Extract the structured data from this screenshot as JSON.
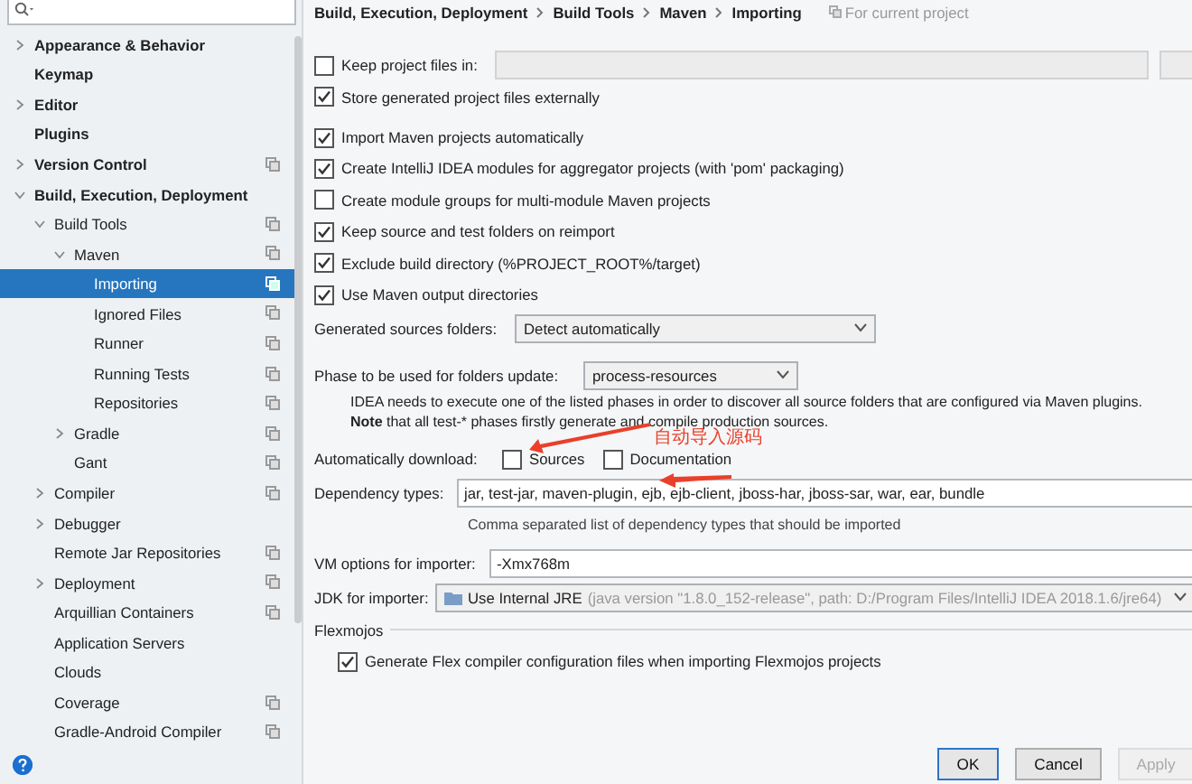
{
  "sidebar": {
    "tree": [
      {
        "label": "Appearance & Behavior",
        "expanded": false,
        "project_level": false,
        "selected": false
      },
      {
        "label": "Keymap",
        "project_level": false,
        "selected": false
      },
      {
        "label": "Editor",
        "expanded": false,
        "project_level": false,
        "selected": false
      },
      {
        "label": "Plugins",
        "project_level": false,
        "selected": false
      },
      {
        "label": "Version Control",
        "expanded": false,
        "project_level": true,
        "selected": false
      },
      {
        "label": "Build, Execution, Deployment",
        "expanded": true,
        "project_level": false,
        "selected": false,
        "children": [
          {
            "label": "Build Tools",
            "expanded": true,
            "project_level": true,
            "selected": false,
            "children": [
              {
                "label": "Maven",
                "expanded": true,
                "project_level": true,
                "selected": false,
                "children": [
                  {
                    "label": "Importing",
                    "project_level": true,
                    "selected": true
                  },
                  {
                    "label": "Ignored Files",
                    "project_level": true,
                    "selected": false
                  },
                  {
                    "label": "Runner",
                    "project_level": true,
                    "selected": false
                  },
                  {
                    "label": "Running Tests",
                    "project_level": true,
                    "selected": false
                  },
                  {
                    "label": "Repositories",
                    "project_level": true,
                    "selected": false
                  }
                ]
              },
              {
                "label": "Gradle",
                "expanded": false,
                "project_level": true,
                "selected": false
              },
              {
                "label": "Gant",
                "project_level": true,
                "selected": false
              }
            ]
          },
          {
            "label": "Compiler",
            "expanded": false,
            "project_level": true,
            "selected": false
          },
          {
            "label": "Debugger",
            "expanded": false,
            "project_level": false,
            "selected": false
          },
          {
            "label": "Remote Jar Repositories",
            "project_level": true,
            "selected": false
          },
          {
            "label": "Deployment",
            "expanded": false,
            "project_level": true,
            "selected": false
          },
          {
            "label": "Arquillian Containers",
            "project_level": true,
            "selected": false
          },
          {
            "label": "Application Servers",
            "project_level": false,
            "selected": false
          },
          {
            "label": "Clouds",
            "project_level": false,
            "selected": false
          },
          {
            "label": "Coverage",
            "project_level": true,
            "selected": false
          },
          {
            "label": "Gradle-Android Compiler",
            "project_level": true,
            "selected": false
          }
        ]
      }
    ]
  },
  "breadcrumb": [
    "Build, Execution, Deployment",
    "Build Tools",
    "Maven",
    "Importing"
  ],
  "scope_note": "For current project",
  "keep_project_files": {
    "label": "Keep project files in:",
    "checked": false
  },
  "store_externally": {
    "label": "Store generated project files externally",
    "checked": true
  },
  "import_options": [
    {
      "label": "Import Maven projects automatically",
      "checked": true
    },
    {
      "label": "Create IntelliJ IDEA modules for aggregator projects (with 'pom' packaging)",
      "checked": true
    },
    {
      "label": "Create module groups for multi-module Maven projects",
      "checked": false
    },
    {
      "label": "Keep source and test folders on reimport",
      "checked": true
    },
    {
      "label": "Exclude build directory (%PROJECT_ROOT%/target)",
      "checked": true
    },
    {
      "label": "Use Maven output directories",
      "checked": true
    }
  ],
  "generated_sources": {
    "label": "Generated sources folders:",
    "value": "Detect automatically"
  },
  "phase": {
    "label": "Phase to be used for folders update:",
    "value": "process-resources",
    "note": "IDEA needs to execute one of the listed phases in order to discover all source folders that are configured via Maven plugins.",
    "note2": "**Note** that all test-* phases firstly generate and compile production sources."
  },
  "auto_download": {
    "label": "Automatically download:",
    "options": [
      {
        "label": "Sources",
        "checked": false
      },
      {
        "label": "Documentation",
        "checked": false
      }
    ]
  },
  "dependency_types": {
    "label": "Dependency types:",
    "value": "jar, test-jar, maven-plugin, ejb, ejb-client, jboss-har, jboss-sar, war, ear, bundle",
    "hint": "Comma separated list of dependency types that should be imported"
  },
  "vm_options": {
    "label": "VM options for importer:",
    "value": "-Xmx768m"
  },
  "jdk": {
    "label": "JDK for importer:",
    "value": "Use Internal JRE",
    "detail": "(java version \"1.8.0_152-release\", path: D:/Program Files/IntelliJ IDEA 2018.1.6/jre64)"
  },
  "flexmojos": {
    "title": "Flexmojos",
    "option": {
      "label": "Generate Flex compiler configuration files when importing Flexmojos projects",
      "checked": true
    }
  },
  "annotation": {
    "text": "自动导入源码"
  },
  "buttons": [
    {
      "label": "OK",
      "default": true,
      "disabled": false
    },
    {
      "label": "Cancel",
      "default": false,
      "disabled": false
    },
    {
      "label": "Apply",
      "default": false,
      "disabled": true
    }
  ]
}
